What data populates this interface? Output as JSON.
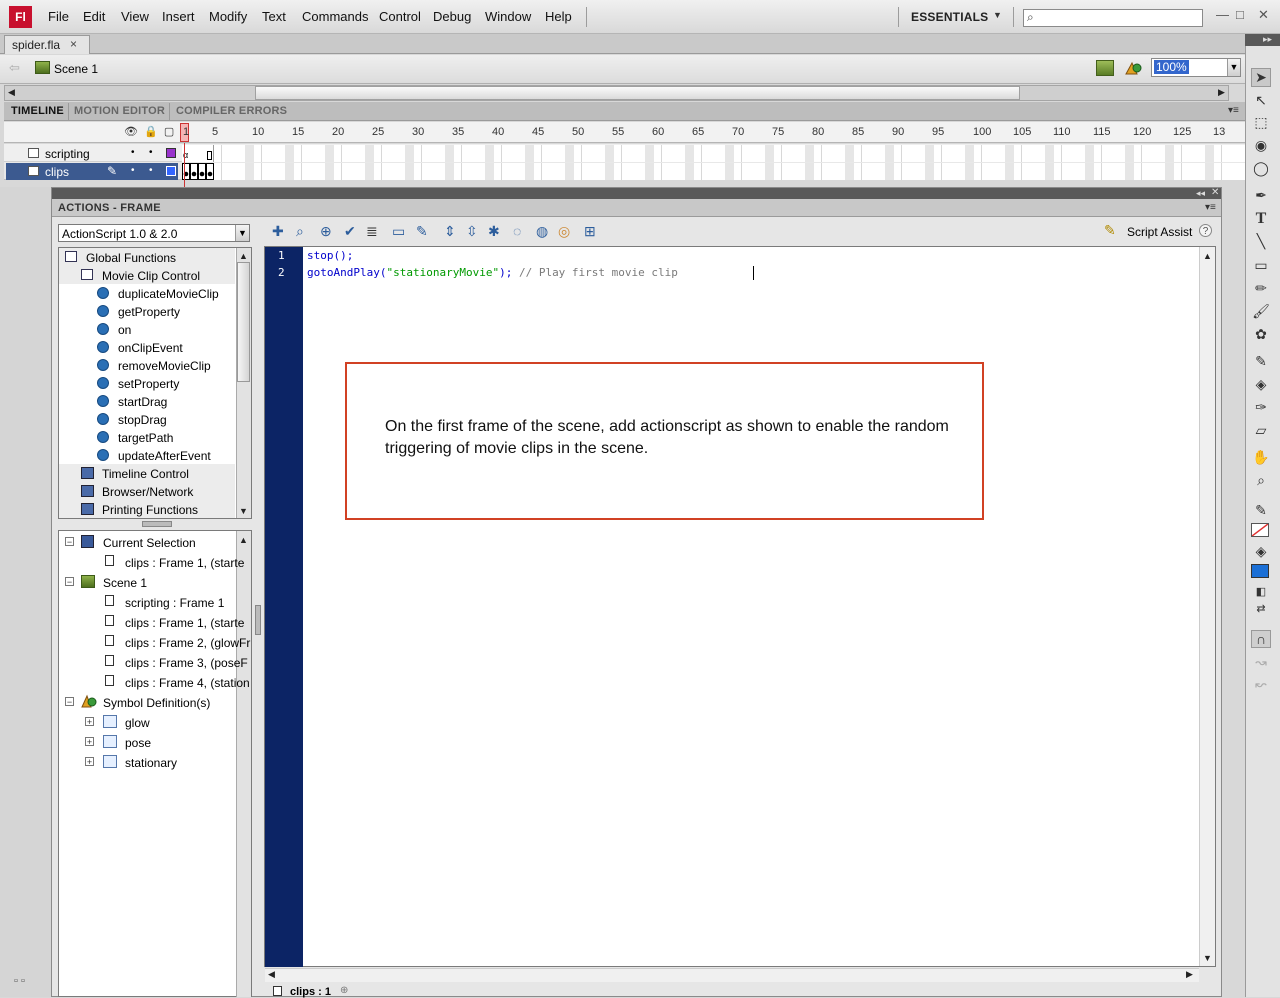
{
  "app": {
    "logo": "Fl",
    "menu": [
      "File",
      "Edit",
      "View",
      "Insert",
      "Modify",
      "Text",
      "Commands",
      "Control",
      "Debug",
      "Window",
      "Help"
    ],
    "workspace": "ESSENTIALS",
    "search_placeholder": "",
    "window_controls": [
      "—",
      "□",
      "✕"
    ]
  },
  "document": {
    "tab_label": "spider.fla",
    "tab_close": "×",
    "scene_label": "Scene 1",
    "zoom": "100%"
  },
  "timeline": {
    "tabs": [
      "TIMELINE",
      "MOTION EDITOR",
      "COMPILER ERRORS"
    ],
    "ruler": [
      "1",
      "5",
      "10",
      "15",
      "20",
      "25",
      "30",
      "35",
      "40",
      "45",
      "50",
      "55",
      "60",
      "65",
      "70",
      "75",
      "80",
      "85",
      "90",
      "95",
      "100",
      "105",
      "110",
      "115",
      "120",
      "125",
      "13"
    ],
    "layers": [
      {
        "name": "scripting",
        "color": "#9933cc",
        "selected": false
      },
      {
        "name": "clips",
        "color": "#3366ff",
        "selected": true
      }
    ]
  },
  "actions": {
    "title": "ACTIONS - FRAME",
    "language": "ActionScript 1.0 & 2.0",
    "toolbox": [
      {
        "label": "Global Functions",
        "kind": "book",
        "level": 0
      },
      {
        "label": "Movie Clip Control",
        "kind": "book",
        "level": 1
      },
      {
        "label": "duplicateMovieClip",
        "kind": "fn",
        "level": 2
      },
      {
        "label": "getProperty",
        "kind": "fn",
        "level": 2
      },
      {
        "label": "on",
        "kind": "fn",
        "level": 2
      },
      {
        "label": "onClipEvent",
        "kind": "fn",
        "level": 2
      },
      {
        "label": "removeMovieClip",
        "kind": "fn",
        "level": 2
      },
      {
        "label": "setProperty",
        "kind": "fn",
        "level": 2
      },
      {
        "label": "startDrag",
        "kind": "fn",
        "level": 2
      },
      {
        "label": "stopDrag",
        "kind": "fn",
        "level": 2
      },
      {
        "label": "targetPath",
        "kind": "fn",
        "level": 2
      },
      {
        "label": "updateAfterEvent",
        "kind": "fn",
        "level": 2
      },
      {
        "label": "Timeline Control",
        "kind": "cat",
        "level": 1
      },
      {
        "label": "Browser/Network",
        "kind": "cat",
        "level": 1
      },
      {
        "label": "Printing Functions",
        "kind": "cat",
        "level": 1
      }
    ],
    "navigator": [
      {
        "label": "Current Selection",
        "kind": "group",
        "expander": "−"
      },
      {
        "label": "clips : Frame 1, (starte",
        "kind": "frame"
      },
      {
        "label": "Scene 1",
        "kind": "scene",
        "expander": "−"
      },
      {
        "label": "scripting : Frame 1",
        "kind": "frame"
      },
      {
        "label": "clips : Frame 1, (starte",
        "kind": "frame"
      },
      {
        "label": "clips : Frame 2, (glowFr",
        "kind": "frame"
      },
      {
        "label": "clips : Frame 3, (poseF",
        "kind": "frame"
      },
      {
        "label": "clips : Frame 4, (station",
        "kind": "frame"
      },
      {
        "label": "Symbol Definition(s)",
        "kind": "symbols",
        "expander": "−"
      },
      {
        "label": "glow",
        "kind": "symbol",
        "expander": "+"
      },
      {
        "label": "pose",
        "kind": "symbol",
        "expander": "+"
      },
      {
        "label": "stationary",
        "kind": "symbol",
        "expander": "+"
      }
    ],
    "script_assist": "Script Assist",
    "help": "?",
    "code": {
      "line_numbers": [
        "1",
        "2"
      ],
      "line1": "stop();",
      "line2_fn": "gotoAndPlay(",
      "line2_str": "\"stationaryMovie\"",
      "line2_rest": ");",
      "line2_comment": " // Play first movie clip"
    },
    "status_label": "clips : 1"
  },
  "callout": {
    "text": "On the first frame of the scene, add actionscript as shown to enable the random triggering of movie clips in the scene."
  }
}
